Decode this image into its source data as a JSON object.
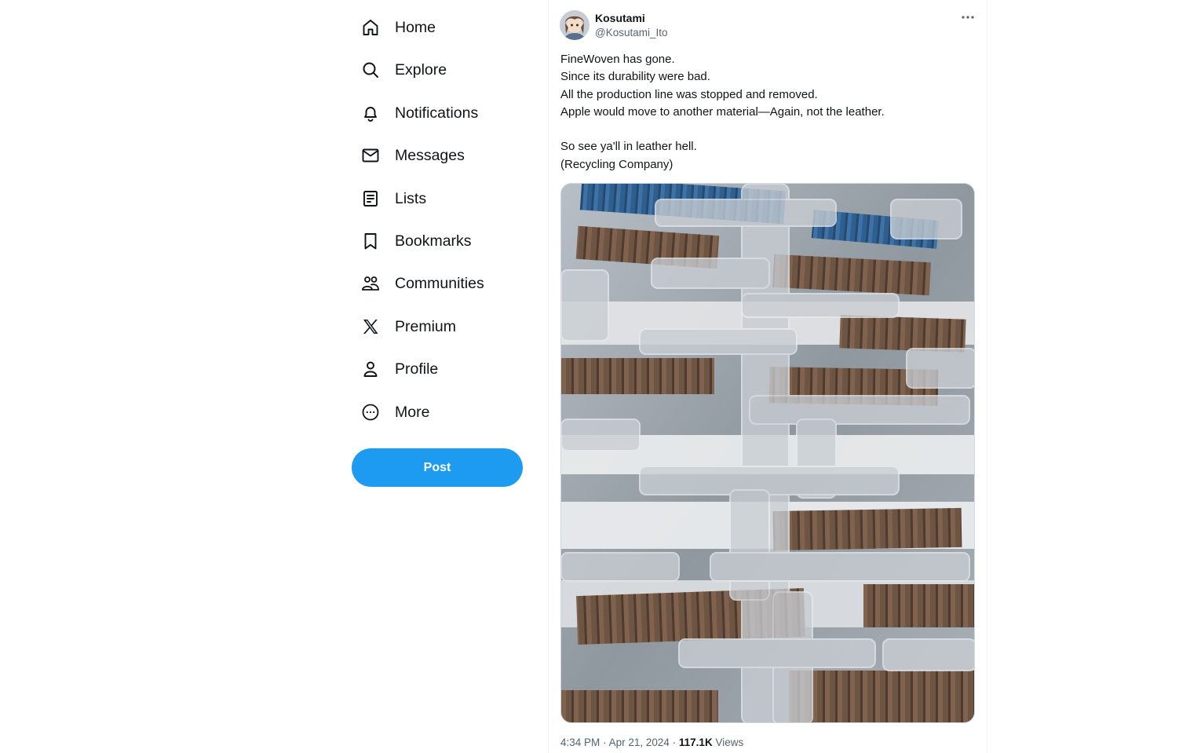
{
  "sidebar": {
    "items": [
      {
        "label": "Home",
        "icon": "home-icon"
      },
      {
        "label": "Explore",
        "icon": "search-icon"
      },
      {
        "label": "Notifications",
        "icon": "bell-icon"
      },
      {
        "label": "Messages",
        "icon": "envelope-icon"
      },
      {
        "label": "Lists",
        "icon": "list-icon"
      },
      {
        "label": "Bookmarks",
        "icon": "bookmark-icon"
      },
      {
        "label": "Communities",
        "icon": "communities-icon"
      },
      {
        "label": "Premium",
        "icon": "x-logo-icon"
      },
      {
        "label": "Profile",
        "icon": "person-icon"
      },
      {
        "label": "More",
        "icon": "more-circle-icon"
      }
    ],
    "post_button": "Post"
  },
  "tweet": {
    "author_name": "Kosutami",
    "author_handle": "@Kosutami_Ito",
    "text_lines": [
      "FineWoven has gone.",
      "Since its durability were bad.",
      "All the production line was stopped and removed.",
      "Apple would move to another material—Again, not the leather."
    ],
    "text_lines_2": [
      "So see ya'll in leather hell.",
      "(Recycling Company)"
    ],
    "time": "4:34 PM",
    "date": "Apr 21, 2024",
    "views_count": "117.1K",
    "views_label": "Views",
    "separator": "·"
  },
  "colors": {
    "accent": "#1d9bf0",
    "text_primary": "#0f1419",
    "text_secondary": "#536471"
  }
}
